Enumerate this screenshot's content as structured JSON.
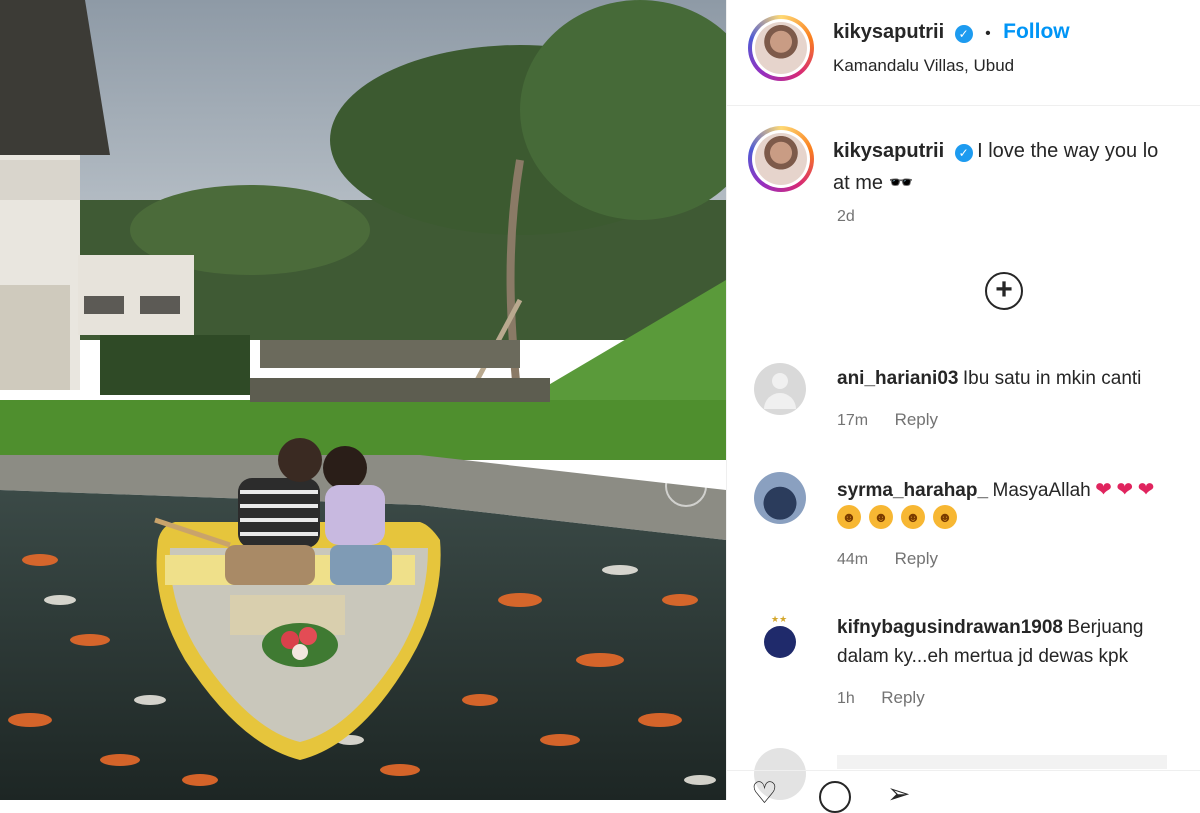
{
  "post": {
    "image_alt": "Couple in a yellow boat on a koi pond",
    "author": "kikysaputrii",
    "location": "Kamandalu Villas, Ubud",
    "follow_label": "Follow",
    "dot": "•",
    "caption_line1": "I love the way you lo",
    "caption_line2": "at me 🕶️",
    "time": "2d",
    "load_more": "+"
  },
  "comments": [
    {
      "user": "ani_hariani03",
      "text": "Ibu satu in mkin canti",
      "time": "17m",
      "reply": "Reply"
    },
    {
      "user": "syrma_harahap_",
      "text": "MasyaAllah",
      "time": "44m",
      "reply": "Reply"
    },
    {
      "user": "kifnybagusindrawan1908",
      "text": "Berjuang",
      "text2": "dalam ky...eh mertua jd dewas kpk",
      "time": "1h",
      "reply": "Reply"
    }
  ],
  "icons": [
    "verified-icon",
    "add-circle-icon",
    "heart-icon",
    "comment-icon",
    "share-icon"
  ]
}
